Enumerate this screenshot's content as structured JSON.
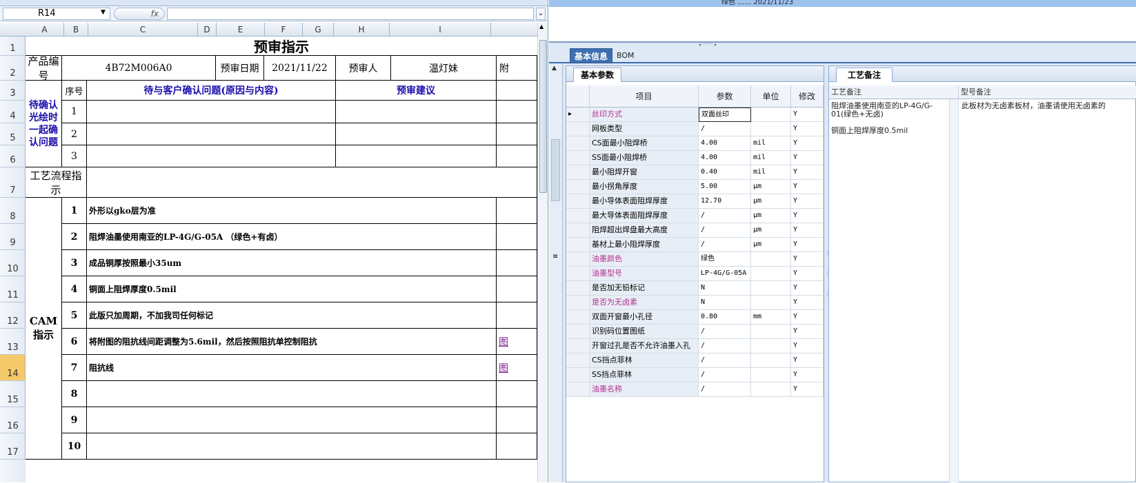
{
  "excel": {
    "name_box": "R14",
    "fx": "fx",
    "columns": [
      "A",
      "B",
      "C",
      "D",
      "E",
      "F",
      "G",
      "H",
      "I"
    ],
    "rows": [
      "1",
      "2",
      "3",
      "4",
      "5",
      "6",
      "7",
      "8",
      "9",
      "10",
      "11",
      "12",
      "13",
      "14",
      "15",
      "16",
      "17"
    ],
    "title": "预审指示",
    "product_label": "产品编号",
    "product_no": "4B72M006A0",
    "review_date_label": "预审日期",
    "review_date": "2021/11/22",
    "reviewer_label": "预审人",
    "reviewer": "温灯妹",
    "attach_label": "附",
    "seq_label": "序号",
    "pending_header": "待与客户确认问题(原因与内容)",
    "suggest_header": "预审建议",
    "confirm_label": "待确认光绘时一起确认问题",
    "confirm_rows": [
      "1",
      "2",
      "3"
    ],
    "process_label": "工艺流程指示",
    "cam_label": "CAM指示",
    "cam_rows": [
      {
        "no": "1",
        "text": "外形以gko层为准",
        "link": ""
      },
      {
        "no": "2",
        "text": "阻焊油墨使用南亚的LP-4G/G-05A （绿色+有卤）",
        "link": ""
      },
      {
        "no": "3",
        "text": "成品铜厚按照最小35um",
        "link": ""
      },
      {
        "no": "4",
        "text": "铜面上阻焊厚度0.5mil",
        "link": ""
      },
      {
        "no": "5",
        "text": "此版只加周期，不加我司任何标记",
        "link": ""
      },
      {
        "no": "6",
        "text": "将附图的阻抗线间距调整为5.6mil，然后按照阻抗单控制阻抗",
        "link": "图"
      },
      {
        "no": "7",
        "text": "阻抗线",
        "link": "图"
      },
      {
        "no": "8",
        "text": "",
        "link": ""
      },
      {
        "no": "9",
        "text": "",
        "link": ""
      },
      {
        "no": "10",
        "text": "",
        "link": ""
      }
    ]
  },
  "app": {
    "top_row_text": "绿色  ……  2021/11/23",
    "tabs": [
      "基本信息",
      "BOM"
    ],
    "panel_a_tab": "基本参数",
    "grid_headers": [
      "项目",
      "参数",
      "单位",
      "修改"
    ],
    "grid_rows": [
      {
        "item": "丝印方式",
        "value": "双面丝印",
        "unit": "",
        "flag": "Y",
        "pink": true,
        "current": true
      },
      {
        "item": "网板类型",
        "value": "/",
        "unit": "",
        "flag": "Y",
        "pink": false,
        "current": false
      },
      {
        "item": "CS面最小阻焊桥",
        "value": "4.00",
        "unit": "mil",
        "flag": "Y",
        "pink": false,
        "current": false
      },
      {
        "item": "SS面最小阻焊桥",
        "value": "4.00",
        "unit": "mil",
        "flag": "Y",
        "pink": false,
        "current": false
      },
      {
        "item": "最小阻焊开窗",
        "value": "0.40",
        "unit": "mil",
        "flag": "Y",
        "pink": false,
        "current": false
      },
      {
        "item": "最小拐角厚度",
        "value": "5.00",
        "unit": "μm",
        "flag": "Y",
        "pink": false,
        "current": false
      },
      {
        "item": "最小导体表面阻焊厚度",
        "value": "12.70",
        "unit": "μm",
        "flag": "Y",
        "pink": false,
        "current": false
      },
      {
        "item": "最大导体表面阻焊厚度",
        "value": "/",
        "unit": "μm",
        "flag": "Y",
        "pink": false,
        "current": false
      },
      {
        "item": "阻焊超出焊盘最大高度",
        "value": "/",
        "unit": "μm",
        "flag": "Y",
        "pink": false,
        "current": false
      },
      {
        "item": "基材上最小阻焊厚度",
        "value": "/",
        "unit": "μm",
        "flag": "Y",
        "pink": false,
        "current": false
      },
      {
        "item": "油墨颜色",
        "value": "绿色",
        "unit": "",
        "flag": "Y",
        "pink": true,
        "current": false
      },
      {
        "item": "油墨型号",
        "value": "LP-4G/G-05A",
        "unit": "",
        "flag": "Y",
        "pink": true,
        "current": false
      },
      {
        "item": "是否加无铅标记",
        "value": "N",
        "unit": "",
        "flag": "Y",
        "pink": false,
        "current": false
      },
      {
        "item": "是否为无卤素",
        "value": "N",
        "unit": "",
        "flag": "Y",
        "pink": true,
        "current": false
      },
      {
        "item": "双面开窗最小孔径",
        "value": "0.80",
        "unit": "mm",
        "flag": "Y",
        "pink": false,
        "current": false
      },
      {
        "item": "识别码位置图纸",
        "value": "/",
        "unit": "",
        "flag": "Y",
        "pink": false,
        "current": false
      },
      {
        "item": "开窗过孔是否不允许油墨入孔",
        "value": "/",
        "unit": "",
        "flag": "Y",
        "pink": false,
        "current": false
      },
      {
        "item": "CS挡点菲林",
        "value": "/",
        "unit": "",
        "flag": "Y",
        "pink": false,
        "current": false
      },
      {
        "item": "SS挡点菲林",
        "value": "/",
        "unit": "",
        "flag": "Y",
        "pink": false,
        "current": false
      },
      {
        "item": "油墨名称",
        "value": "/",
        "unit": "",
        "flag": "Y",
        "pink": true,
        "current": false
      }
    ],
    "panel_b_tab": "工艺备注",
    "note_headers": [
      "工艺备注",
      "型号备注"
    ],
    "process_note": "阻焊油墨使用南亚的LP-4G/G-01(绿色+无卤)\n\n铜面上阻焊厚度0.5mil",
    "model_note": "此板材为无卤素板材，油墨请使用无卤素的"
  },
  "colors": {
    "excel_blue_text": "#1a0dab",
    "pink_item": "#b4328f",
    "tab_active": "#3d6fb0",
    "selected_row_header": "#f5c969"
  }
}
